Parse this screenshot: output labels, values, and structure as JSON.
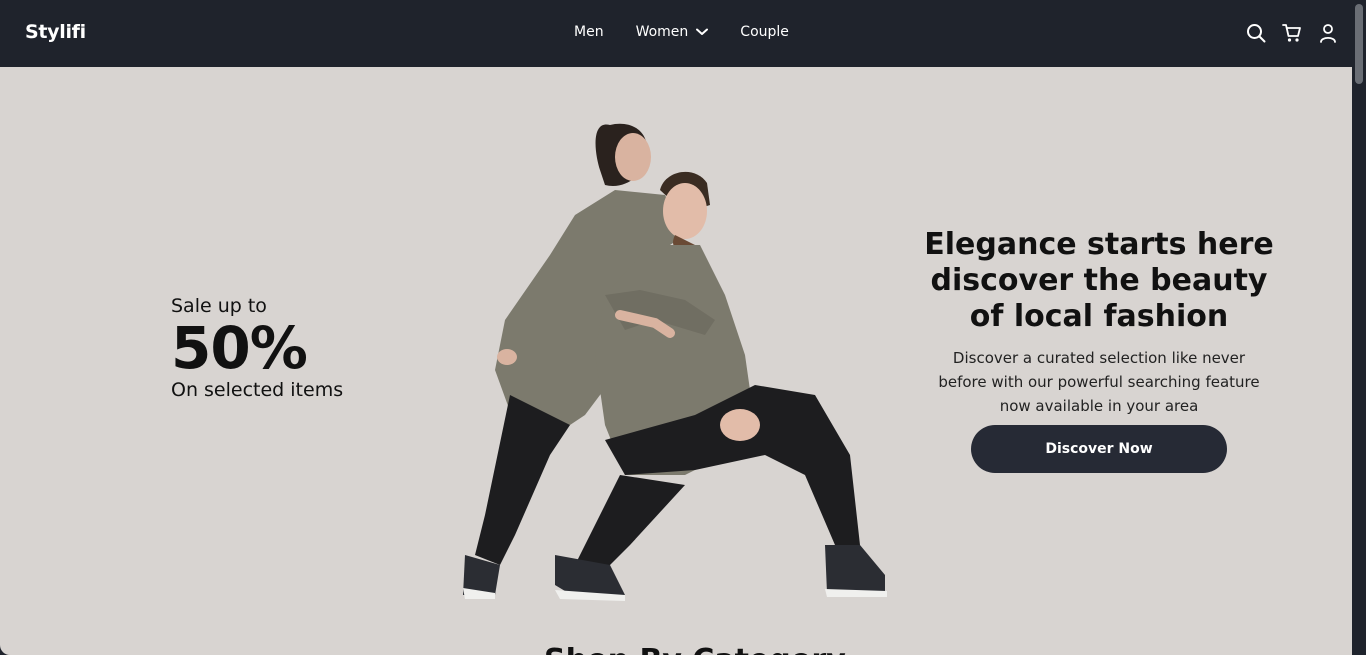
{
  "brand": "Stylifi",
  "nav": {
    "items": [
      {
        "label": "Men"
      },
      {
        "label": "Women",
        "has_dropdown": true
      },
      {
        "label": "Couple"
      }
    ],
    "icons": [
      "search-icon",
      "cart-icon",
      "user-icon"
    ]
  },
  "hero": {
    "sale_top": "Sale up to",
    "sale_percent": "50%",
    "sale_bottom": "On selected items",
    "headline": "Elegance starts here discover the beauty of local fashion",
    "subtext": "Discover a curated selection like never before with our powerful searching feature now available in your area",
    "cta_label": "Discover Now"
  },
  "next_section": {
    "title": "Shop By Category"
  },
  "colors": {
    "navbar": "#1f232c",
    "hero_bg": "#d8d4d1",
    "button": "#262a35",
    "jacket": "#7c7a6d",
    "pants": "#1d1d1f"
  }
}
